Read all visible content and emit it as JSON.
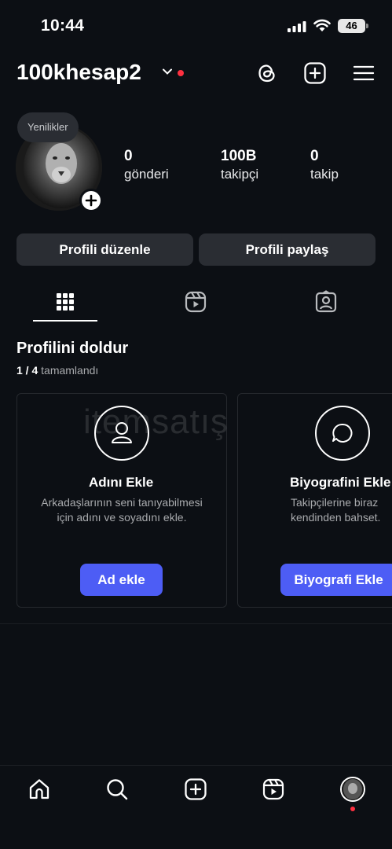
{
  "status_bar": {
    "time": "10:44",
    "battery": "46"
  },
  "header": {
    "username": "100khesap2",
    "icons": [
      "threads-icon",
      "add-icon",
      "menu-icon"
    ]
  },
  "profile": {
    "bubble": "Yenilikler",
    "stats": [
      {
        "value": "0",
        "label": "gönderi"
      },
      {
        "value": "100B",
        "label": "takipçi"
      },
      {
        "value": "0",
        "label": "takip"
      }
    ]
  },
  "buttons": {
    "edit": "Profili düzenle",
    "share": "Profili paylaş"
  },
  "tabs": [
    "grid-icon",
    "reels-icon",
    "tagged-icon"
  ],
  "complete": {
    "title": "Profilini doldur",
    "progress": "1 / 4",
    "progress_suffix": "tamamlandı",
    "cards": [
      {
        "title": "Adını Ekle",
        "desc1": "Arkadaşlarının seni tanıyabilmesi",
        "desc2": "için adını ve soyadını ekle.",
        "button": "Ad ekle",
        "icon": "person-icon"
      },
      {
        "title": "Biyografini Ekle",
        "desc1": "Takipçilerine biraz",
        "desc2": "kendinden bahset.",
        "button": "Biyografi Ekle",
        "icon": "chat-bubble-icon"
      }
    ]
  },
  "watermark": "itemsatış",
  "nav": [
    "home-icon",
    "search-icon",
    "create-icon",
    "reels-icon",
    "profile-avatar"
  ],
  "colors": {
    "accent": "#4d5df5",
    "background": "#0c0f14",
    "notification": "#ff3040"
  }
}
